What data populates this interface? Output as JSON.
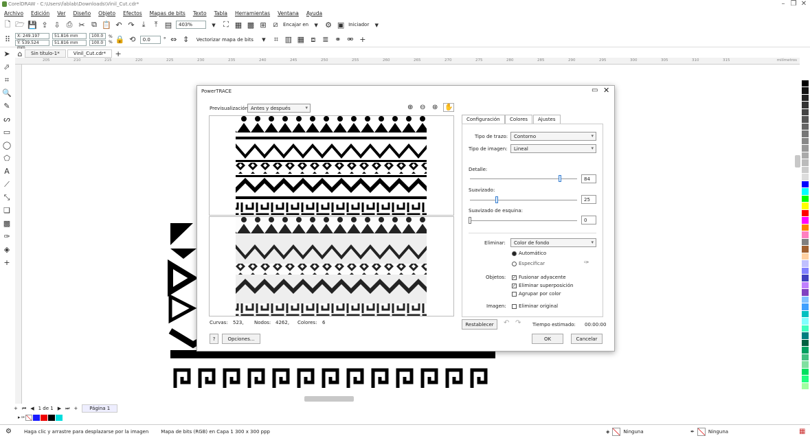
{
  "window": {
    "title": "CorelDRAW - C:\\Users\\fablab\\Downloads\\Vinil_Cut.cdr*"
  },
  "menu": [
    "Archivo",
    "Edición",
    "Ver",
    "Diseño",
    "Objeto",
    "Efectos",
    "Mapas de bits",
    "Texto",
    "Tabla",
    "Herramientas",
    "Ventana",
    "Ayuda"
  ],
  "toolbar": {
    "zoom": "403%",
    "snap_label": "Encajar en",
    "launcher_label": "Iniciador"
  },
  "props": {
    "x": "X: 249.197 mm",
    "y": "Y: 539.524 mm",
    "w": "51.816 mm",
    "h": "51.816 mm",
    "sx": "100.0",
    "sy": "100.0",
    "pct": "%",
    "rotation": "0.0",
    "rot_unit": "°",
    "vectorize": "Vectorizar mapa de bits"
  },
  "doc_tabs": [
    "Sin título-1*",
    "Vinil_Cut.cdr*"
  ],
  "ruler": {
    "unit": "milímetros",
    "ticks": [
      "205",
      "210",
      "215",
      "220",
      "225",
      "230",
      "235",
      "240",
      "245",
      "250",
      "255",
      "260",
      "265",
      "270",
      "275",
      "280",
      "285",
      "290",
      "295",
      "300",
      "305",
      "310",
      "315"
    ]
  },
  "page_nav": {
    "info": "1 de 1",
    "page_label": "Página 1"
  },
  "dialog": {
    "title": "PowerTRACE",
    "preview_label": "Previsualización:",
    "preview_mode": "Antes y después",
    "tabs": [
      "Configuración",
      "Colores",
      "Ajustes"
    ],
    "trace_type_label": "Tipo de trazo:",
    "trace_type": "Contorno",
    "image_type_label": "Tipo de imagen:",
    "image_type": "Lineal",
    "detail_label": "Detalle:",
    "detail": "84",
    "detail_level": 0.84,
    "smoothing_label": "Suavizado:",
    "smoothing": "25",
    "smoothing_level": 0.25,
    "corner_label": "Suavizado de esquina:",
    "corner": "0",
    "corner_level": 0,
    "remove_label": "Eliminar:",
    "remove_value": "Color de fondo",
    "auto_label": "Automático",
    "specify_label": "Especificar",
    "objects_label": "Objetos:",
    "merge_label": "Fusionar adyacente",
    "overlap_label": "Eliminar superposición",
    "group_label": "Agrupar por color",
    "image_label": "Imagen:",
    "delete_original_label": "Eliminar original",
    "stats_curves_label": "Curvas:",
    "stats_curves": "523,",
    "stats_nodes_label": "Nodos:",
    "stats_nodes": "4262,",
    "stats_colors_label": "Colores:",
    "stats_colors": "6",
    "reset": "Restablecer",
    "time_label": "Tiempo estimado:",
    "time": "00:00:00",
    "help": "?",
    "options": "Opciones...",
    "ok": "OK",
    "cancel": "Cancelar"
  },
  "fill_status": "Ninguna",
  "outline_status": "Ninguna",
  "status": {
    "hint": "Haga clic y arrastre para desplazarse por la imagen",
    "object": "Mapa de bits (RGB) en Capa 1 300 x 300 ppp"
  },
  "colors": {
    "palette": [
      "#ffffff",
      "#000000",
      "#111111",
      "#222222",
      "#333333",
      "#444444",
      "#555555",
      "#666666",
      "#777777",
      "#888888",
      "#999999",
      "#aaaaaa",
      "#bbbbbb",
      "#cccccc",
      "#dddddd",
      "#0000ff",
      "#00ffff",
      "#00ff00",
      "#ffff00",
      "#ff0000",
      "#ff00ff",
      "#ff8000",
      "#ff80c0",
      "#808080",
      "#a06030",
      "#ffd0a0",
      "#c0c0ff",
      "#8080ff",
      "#4040c0",
      "#c080ff",
      "#8040c0",
      "#80c0ff",
      "#40a0ff",
      "#00c0c0",
      "#80ffff",
      "#40ffc0",
      "#008080",
      "#006040",
      "#00a060",
      "#40c080",
      "#80e0a0",
      "#00e060",
      "#20ff80",
      "#a0ffa0"
    ]
  }
}
